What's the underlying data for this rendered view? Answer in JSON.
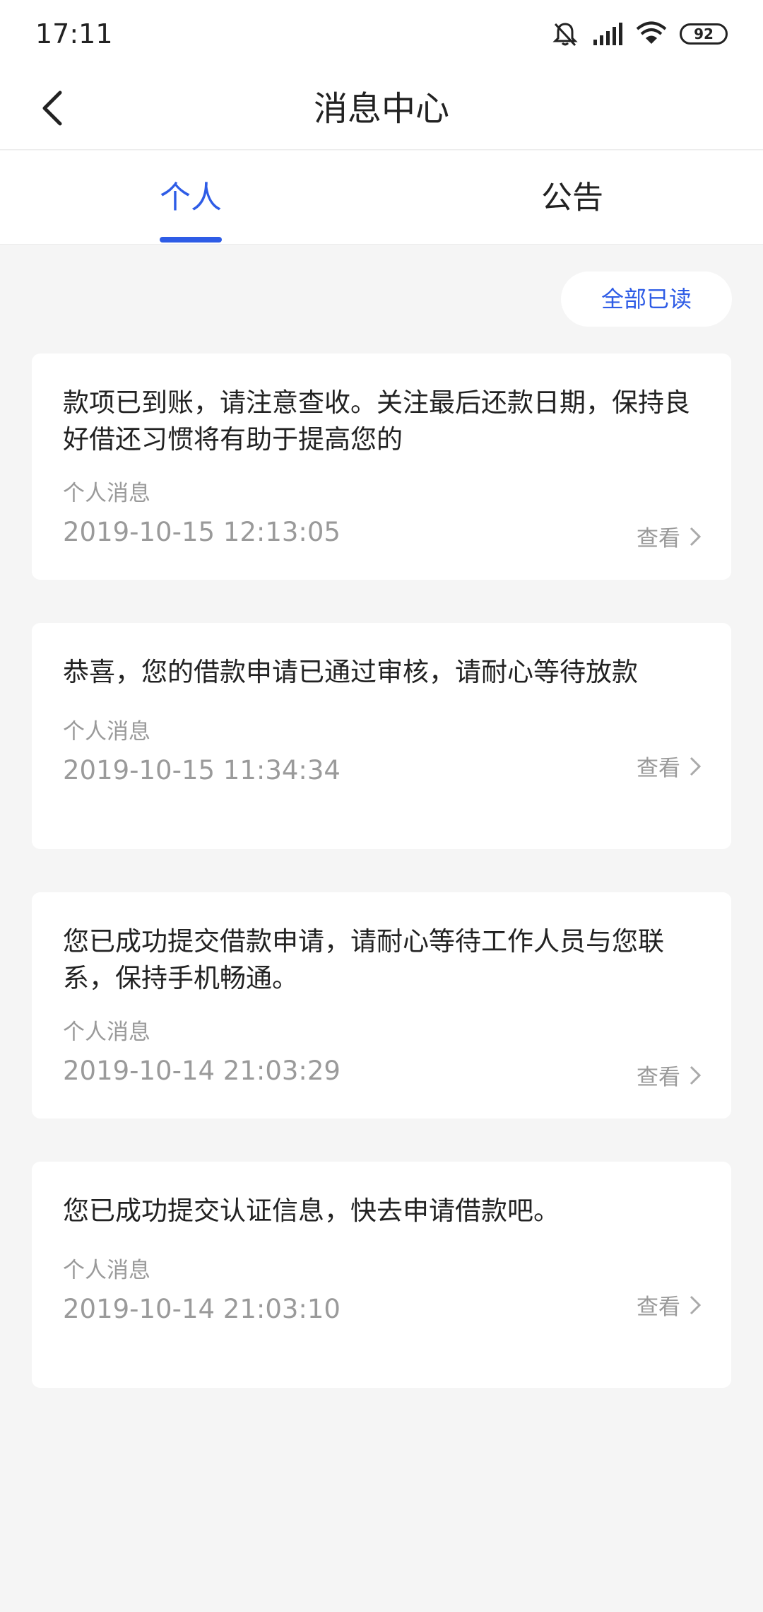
{
  "status_bar": {
    "time": "17:11",
    "battery": "92",
    "icons": [
      "mute-bell-icon",
      "signal-icon",
      "wifi-icon",
      "battery-icon"
    ]
  },
  "header": {
    "title": "消息中心",
    "back_icon": "chevron-left-icon"
  },
  "tabs": [
    {
      "label": "个人",
      "active": true
    },
    {
      "label": "公告",
      "active": false
    }
  ],
  "mark_all_read": "全部已读",
  "colors": {
    "accent": "#2e5ce6",
    "background": "#f5f5f5",
    "card": "#ffffff",
    "muted_text": "#9a9a9a"
  },
  "messages": [
    {
      "text": "款项已到账，请注意查收。关注最后还款日期，保持良好借还习惯将有助于提高您的",
      "type": "个人消息",
      "time": "2019-10-15 12:13:05",
      "action": "查看"
    },
    {
      "text": "恭喜，您的借款申请已通过审核，请耐心等待放款",
      "type": "个人消息",
      "time": "2019-10-15 11:34:34",
      "action": "查看"
    },
    {
      "text": "您已成功提交借款申请，请耐心等待工作人员与您联系，保持手机畅通。",
      "type": "个人消息",
      "time": "2019-10-14 21:03:29",
      "action": "查看"
    },
    {
      "text": "您已成功提交认证信息，快去申请借款吧。",
      "type": "个人消息",
      "time": "2019-10-14 21:03:10",
      "action": "查看"
    }
  ]
}
